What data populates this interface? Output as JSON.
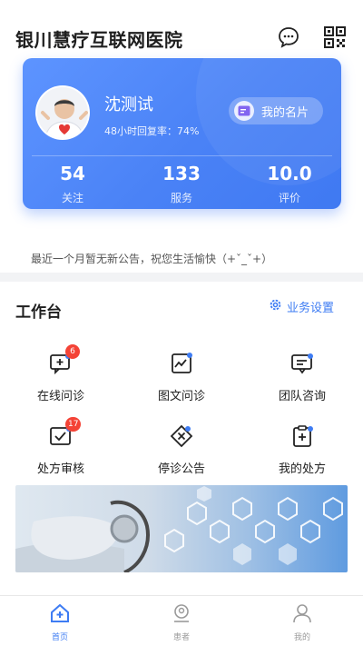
{
  "header": {
    "title": "银川慧疗互联网医院",
    "icons": [
      "message-icon",
      "qr-code-icon"
    ]
  },
  "card": {
    "doctor_name": "沈测试",
    "reply_rate": "48小时回复率：74%",
    "card_button_label": "我的名片",
    "stats": [
      {
        "value": "54",
        "label": "关注"
      },
      {
        "value": "133",
        "label": "服务"
      },
      {
        "value": "10.0",
        "label": "评价"
      }
    ],
    "colors": {
      "gradient_start": "#5d94ff",
      "gradient_end": "#3f79f2"
    }
  },
  "notice": "最近一个月暂无新公告，祝您生活愉快（+ˇ_ˇ+）",
  "workbench": {
    "title": "工作台",
    "settings_label": "业务设置",
    "items": [
      {
        "label": "在线问诊",
        "icon": "online-consult-icon",
        "badge": "6"
      },
      {
        "label": "图文问诊",
        "icon": "image-text-consult-icon",
        "badge": ""
      },
      {
        "label": "团队咨询",
        "icon": "team-consult-icon",
        "badge": ""
      },
      {
        "label": "处方审核",
        "icon": "prescription-review-icon",
        "badge": "17"
      },
      {
        "label": "停诊公告",
        "icon": "suspension-notice-icon",
        "badge": ""
      },
      {
        "label": "我的处方",
        "icon": "my-prescription-icon",
        "badge": ""
      }
    ]
  },
  "tabbar": {
    "items": [
      {
        "label": "首页",
        "icon": "home-icon",
        "active": true
      },
      {
        "label": "患者",
        "icon": "patient-icon",
        "active": false
      },
      {
        "label": "我的",
        "icon": "profile-icon",
        "active": false
      }
    ]
  },
  "accent_color": "#3e7cf3",
  "badge_color": "#f44336"
}
